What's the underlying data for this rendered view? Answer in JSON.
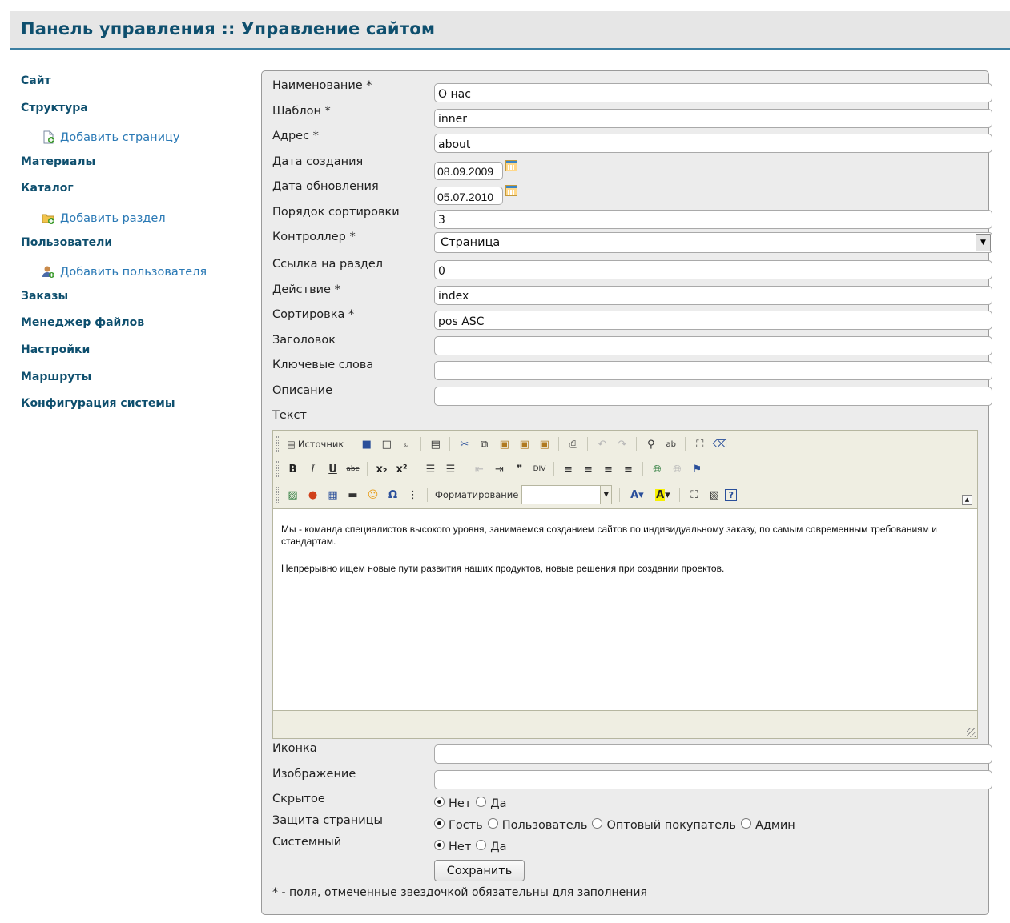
{
  "header": {
    "title": "Панель управления :: Управление сайтом"
  },
  "sidebar": {
    "items": [
      {
        "label": "Сайт",
        "type": "main"
      },
      {
        "label": "Структура",
        "type": "main"
      },
      {
        "label": "Добавить страницу",
        "type": "sub",
        "icon": "add-page-icon"
      },
      {
        "label": "Материалы",
        "type": "main"
      },
      {
        "label": "Каталог",
        "type": "main"
      },
      {
        "label": "Добавить раздел",
        "type": "sub",
        "icon": "add-folder-icon"
      },
      {
        "label": "Пользователи",
        "type": "main"
      },
      {
        "label": "Добавить пользователя",
        "type": "sub",
        "icon": "add-user-icon"
      },
      {
        "label": "Заказы",
        "type": "main"
      },
      {
        "label": "Менеджер файлов",
        "type": "main"
      },
      {
        "label": "Настройки",
        "type": "main"
      },
      {
        "label": "Маршруты",
        "type": "main"
      },
      {
        "label": "Конфигурация системы",
        "type": "main"
      }
    ]
  },
  "form": {
    "name": {
      "label": "Наименование *",
      "value": "О нас"
    },
    "template": {
      "label": "Шаблон *",
      "value": "inner"
    },
    "address": {
      "label": "Адрес *",
      "value": "about"
    },
    "created": {
      "label": "Дата создания",
      "value": "08.09.2009"
    },
    "updated": {
      "label": "Дата обновления",
      "value": "05.07.2010"
    },
    "sort_order": {
      "label": "Порядок сортировки",
      "value": "3"
    },
    "controller": {
      "label": "Контроллер *",
      "value": "Страница"
    },
    "section_link": {
      "label": "Ссылка на раздел",
      "value": "0"
    },
    "action": {
      "label": "Действие *",
      "value": "index"
    },
    "sorting": {
      "label": "Сортировка *",
      "value": "pos ASC"
    },
    "heading": {
      "label": "Заголовок",
      "value": ""
    },
    "keywords": {
      "label": "Ключевые слова",
      "value": ""
    },
    "description": {
      "label": "Описание",
      "value": ""
    },
    "text": {
      "label": "Текст"
    },
    "icon": {
      "label": "Иконка",
      "value": ""
    },
    "image": {
      "label": "Изображение",
      "value": ""
    },
    "hidden": {
      "label": "Скрытое",
      "options": [
        "Нет",
        "Да"
      ],
      "selected": "Нет"
    },
    "protection": {
      "label": "Защита страницы",
      "options": [
        "Гость",
        "Пользователь",
        "Оптовый покупатель",
        "Админ"
      ],
      "selected": "Гость"
    },
    "system": {
      "label": "Системный",
      "options": [
        "Нет",
        "Да"
      ],
      "selected": "Нет"
    },
    "save_label": "Сохранить",
    "required_note": "* - поля, отмеченные звездочкой обязательны для заполнения"
  },
  "editor": {
    "source_label": "Источник",
    "format_label": "Форматирование",
    "paragraphs": [
      "Мы - команда специалистов высокого уровня, занимаемся созданием сайтов по индивидуальному заказу, по самым современным требованиям и стандартам.",
      "Непрерывно ищем новые пути развития наших продуктов, новые решения при создании проектов."
    ]
  },
  "colors": {
    "accent": "#0e4f6e",
    "link": "#2a79b5",
    "header_bg": "#e6e6e6",
    "panel_bg": "#ececec"
  }
}
